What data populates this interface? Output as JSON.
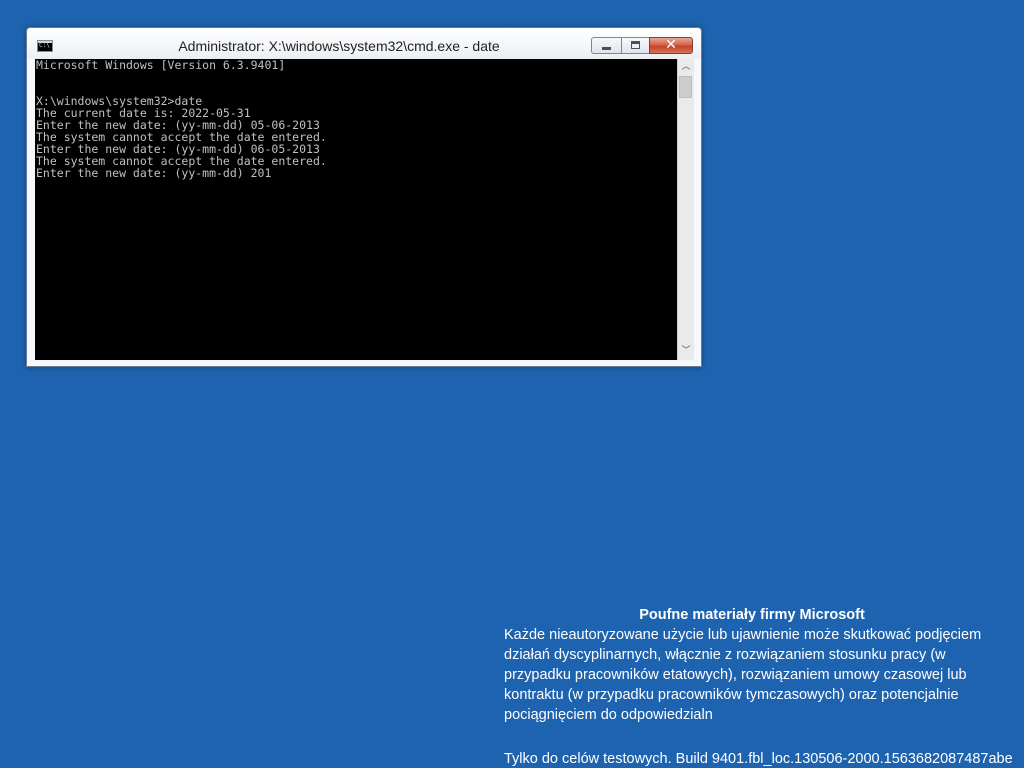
{
  "window": {
    "title": "Administrator: X:\\windows\\system32\\cmd.exe - date",
    "app_icon_text": "C:\\",
    "close_glyph": "✕"
  },
  "console": {
    "lines": [
      "Microsoft Windows [Version 6.3.9401]",
      "",
      "",
      "X:\\windows\\system32>date",
      "The current date is: 2022-05-31",
      "Enter the new date: (yy-mm-dd) 05-06-2013",
      "The system cannot accept the date entered.",
      "Enter the new date: (yy-mm-dd) 06-05-2013",
      "The system cannot accept the date entered.",
      "Enter the new date: (yy-mm-dd) 201"
    ]
  },
  "scrollbar": {
    "up_arrow": "︿",
    "down_arrow": "﹀"
  },
  "watermark": {
    "title": "Poufne materiały firmy Microsoft",
    "lines": [
      "Każde nieautoryzowane użycie lub ujawnienie może skutkować podjęciem",
      "działań dyscyplinarnych, włącznie z rozwiązaniem stosunku pracy (w",
      "przypadku pracowników etatowych), rozwiązaniem umowy czasowej lub",
      "kontraktu (w przypadku pracowników tymczasowych) oraz potencjalnie",
      "pociągnięciem do odpowiedzialn"
    ],
    "build": "Tylko do celów testowych. Build 9401.fbl_loc.130506-2000.1563682087487abe"
  },
  "colors": {
    "desktop_background": "#1e63b0",
    "console_background": "#000000",
    "console_text": "#c0c0c0",
    "close_button": "#c2432a"
  }
}
